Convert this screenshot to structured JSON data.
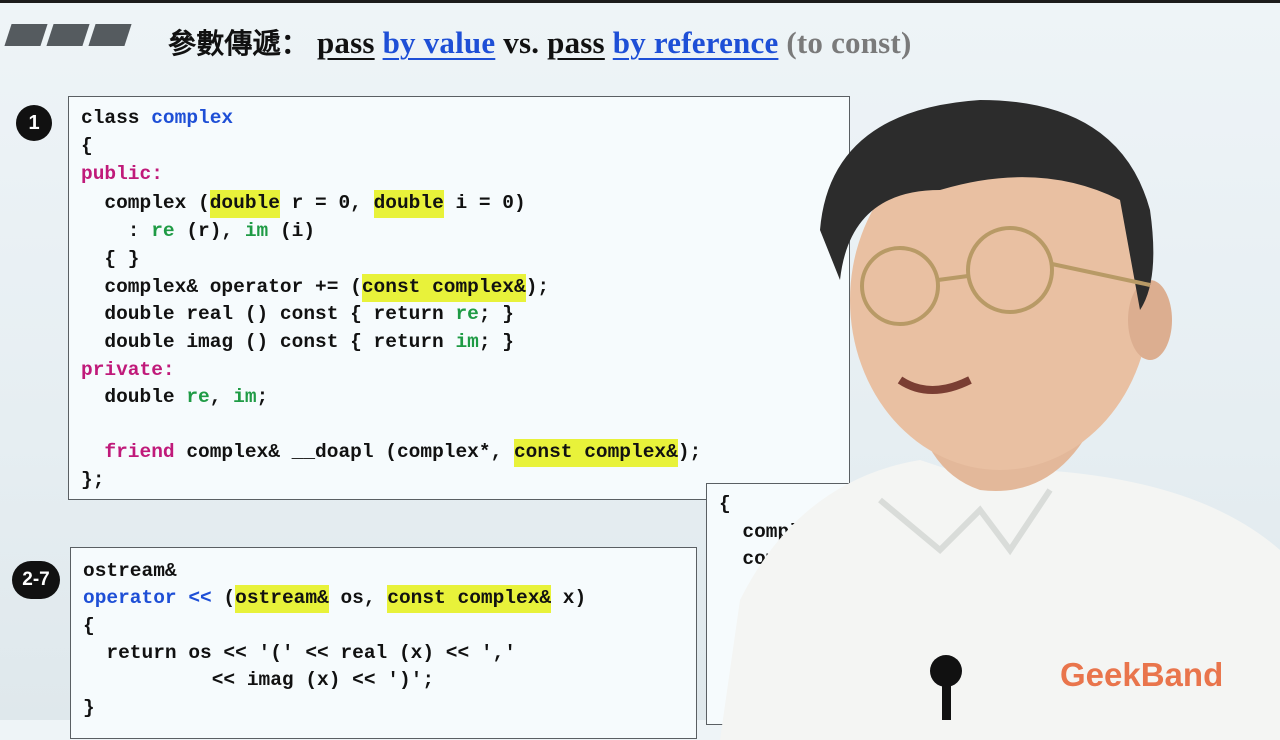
{
  "slide": {
    "title_cjk": "參數傳遞：",
    "title_parts": {
      "pass1": "pass",
      "by_value": "by value",
      "vs": "vs.",
      "pass2": "pass",
      "by_reference": "by reference",
      "to_const": "(to const)"
    },
    "colors": {
      "keyword_blue": "#1e4fd6",
      "member_green": "#1f9b45",
      "access_pink": "#c01a7a",
      "highlight_yellow": "#e8f23a",
      "brand_orange": "#e8683a"
    }
  },
  "box1": {
    "badge": "1",
    "lines": {
      "l1a": "class ",
      "l1b": "complex",
      "l2": "{",
      "l3": "public:",
      "l4a": "  complex (",
      "l4b": "double",
      "l4c": " r = 0, ",
      "l4d": "double",
      "l4e": " i = 0)",
      "l5a": "    : ",
      "l5b": "re",
      "l5c": " (r), ",
      "l5d": "im",
      "l5e": " (i)",
      "l6": "  { }",
      "l7a": "  complex& operator += (",
      "l7b": "const complex&",
      "l7c": ");",
      "l8a": "  double real () const { return ",
      "l8b": "re",
      "l8c": "; }",
      "l9a": "  double imag () const { return ",
      "l9b": "im",
      "l9c": "; }",
      "l10": "private:",
      "l11a": "  double ",
      "l11b": "re",
      "l11c": ", ",
      "l11d": "im",
      "l11e": ";",
      "l12a": "  ",
      "l12b": "friend",
      "l12c": " complex& __doapl (complex*, ",
      "l12d": "const complex&",
      "l12e": ");",
      "l13": "};"
    }
  },
  "box2": {
    "badge": "2-7",
    "lines": {
      "l1": "ostream&",
      "l2a": "operator <<",
      "l2b": " (",
      "l2c": "ostream&",
      "l2d": " os, ",
      "l2e": "const complex&",
      "l2f": " x)",
      "l3": "{",
      "l4": "  return os << '(' << real (x) << ','",
      "l5": "           << imag (x) << ')';",
      "l6": "}"
    }
  },
  "box3": {
    "lines": {
      "l1": "{",
      "l2": "  comple",
      "l3": "  compl",
      "l4": "  c"
    }
  },
  "brand": {
    "logo": "GeekBand"
  }
}
